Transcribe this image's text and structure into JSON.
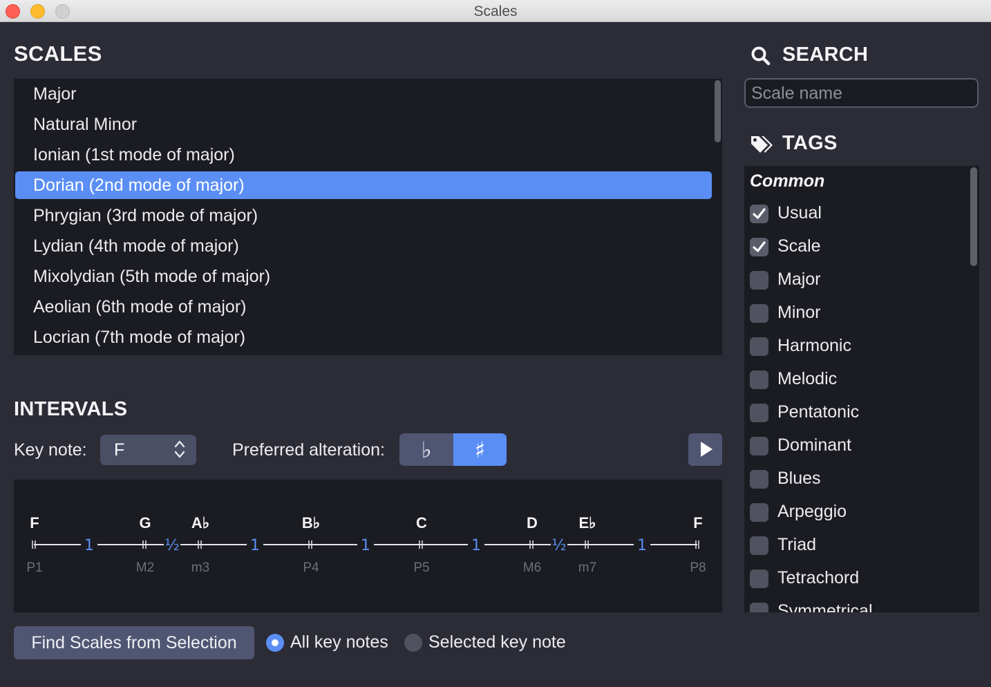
{
  "window": {
    "title": "Scales"
  },
  "scales": {
    "heading": "SCALES",
    "items": [
      "Major",
      "Natural Minor",
      "Ionian (1st mode of major)",
      "Dorian (2nd mode of major)",
      "Phrygian (3rd mode of major)",
      "Lydian (4th mode of major)",
      "Mixolydian (5th mode of major)",
      "Aeolian (6th mode of major)",
      "Locrian (7th mode of major)"
    ],
    "selected_index": 3
  },
  "intervals": {
    "heading": "INTERVALS",
    "key_note_label": "Key note:",
    "key_note_value": "F",
    "alteration_label": "Preferred alteration:",
    "flat_symbol": "♭",
    "sharp_symbol": "♯",
    "selected_alteration": "sharp",
    "notes": [
      "F",
      "G",
      "A♭",
      "B♭",
      "C",
      "D",
      "E♭",
      "F"
    ],
    "degrees": [
      "P1",
      "M2",
      "m3",
      "P4",
      "P5",
      "M6",
      "m7",
      "P8"
    ],
    "steps": [
      "1",
      "½",
      "1",
      "1",
      "1",
      "½",
      "1"
    ],
    "step_color": "#5b8ef5"
  },
  "search": {
    "heading": "SEARCH",
    "icon": "search-icon",
    "placeholder": "Scale name",
    "value": ""
  },
  "tags": {
    "heading": "TAGS",
    "icon": "tags-icon",
    "group": "Common",
    "items": [
      {
        "label": "Usual",
        "checked": true
      },
      {
        "label": "Scale",
        "checked": true
      },
      {
        "label": "Major",
        "checked": false
      },
      {
        "label": "Minor",
        "checked": false
      },
      {
        "label": "Harmonic",
        "checked": false
      },
      {
        "label": "Melodic",
        "checked": false
      },
      {
        "label": "Pentatonic",
        "checked": false
      },
      {
        "label": "Dominant",
        "checked": false
      },
      {
        "label": "Blues",
        "checked": false
      },
      {
        "label": "Arpeggio",
        "checked": false
      },
      {
        "label": "Triad",
        "checked": false
      },
      {
        "label": "Tetrachord",
        "checked": false
      },
      {
        "label": "Symmetrical",
        "checked": false
      }
    ]
  },
  "footer": {
    "find_button": "Find Scales from Selection",
    "radio_all": "All key notes",
    "radio_selected": "Selected key note",
    "radio_value": "all"
  },
  "colors": {
    "accent": "#5b8ef5",
    "background": "#2b2c36",
    "panel": "#1b1c22"
  }
}
